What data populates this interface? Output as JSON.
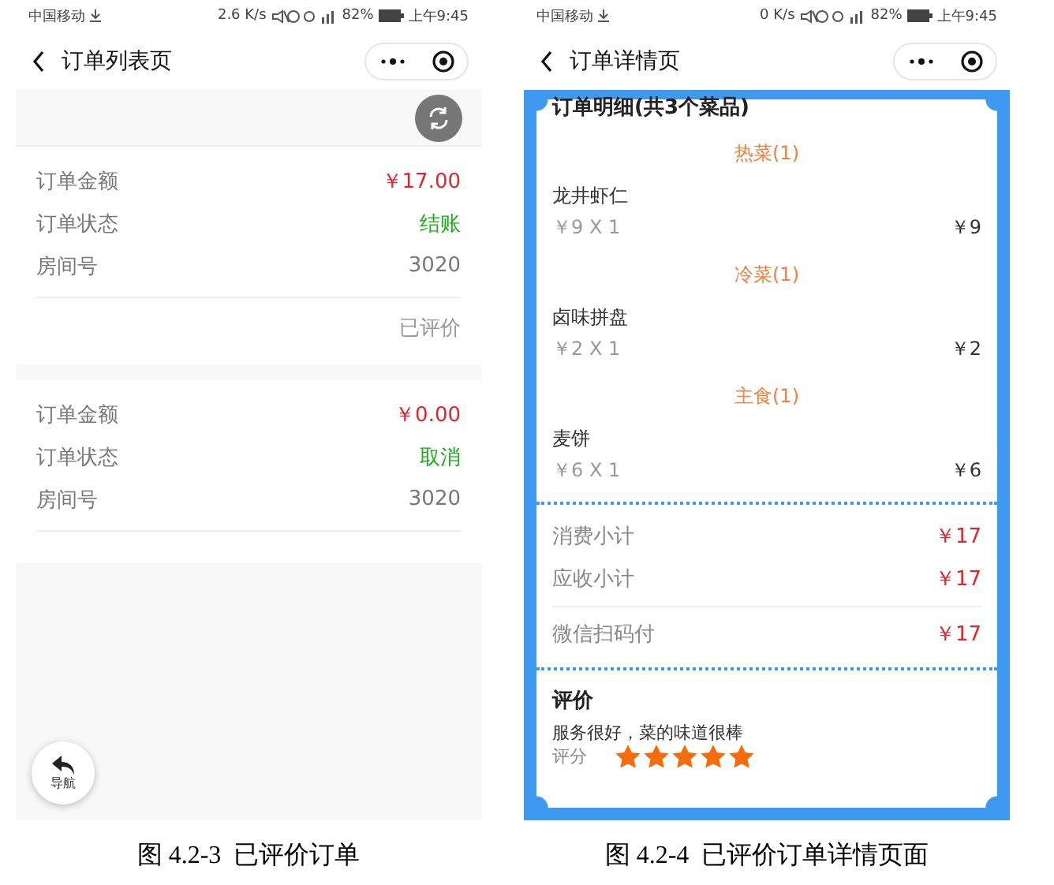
{
  "list_screen": {
    "status_bar": {
      "carrier": "中国移动",
      "speed": "2.6 K/s",
      "battery": "82%",
      "time": "上午9:45"
    },
    "nav": {
      "title": "订单列表页"
    },
    "orders": [
      {
        "rows": [
          {
            "label": "订单金额",
            "value": "￥17.00",
            "kind": "amount"
          },
          {
            "label": "订单状态",
            "value": "结账",
            "kind": "status"
          },
          {
            "label": "房间号",
            "value": "3020",
            "kind": "plain"
          }
        ],
        "footer": "已评价"
      },
      {
        "rows": [
          {
            "label": "订单金额",
            "value": "￥0.00",
            "kind": "amount"
          },
          {
            "label": "订单状态",
            "value": "取消",
            "kind": "status"
          },
          {
            "label": "房间号",
            "value": "3020",
            "kind": "plain"
          }
        ]
      }
    ],
    "nav_button": {
      "label": "导航"
    },
    "caption": "图 4.2-3  已评价订单"
  },
  "detail_screen": {
    "status_bar": {
      "carrier": "中国移动",
      "speed": "0 K/s",
      "battery": "82%",
      "time": "上午9:45"
    },
    "nav": {
      "title": "订单详情页"
    },
    "heading": "订单明细(共3个菜品)",
    "categories": [
      {
        "name": "热菜(1)",
        "items": [
          {
            "name": "龙井虾仁",
            "unit": "￥9 X 1",
            "total": "￥9"
          }
        ]
      },
      {
        "name": "冷菜(1)",
        "items": [
          {
            "name": "卤味拼盘",
            "unit": "￥2 X 1",
            "total": "￥2"
          }
        ]
      },
      {
        "name": "主食(1)",
        "items": [
          {
            "name": "麦饼",
            "unit": "￥6 X 1",
            "total": "￥6"
          }
        ]
      }
    ],
    "subtotals": [
      {
        "label": "消费小计",
        "value": "￥17"
      },
      {
        "label": "应收小计",
        "value": "￥17"
      }
    ],
    "payments": [
      {
        "label": "微信扫码付",
        "value": "￥17"
      }
    ],
    "review": {
      "heading": "评价",
      "comment": "服务很好，菜的味道很棒",
      "score_label": "评分",
      "stars": 5
    },
    "caption": "图 4.2-4  已评价订单详情页面"
  }
}
